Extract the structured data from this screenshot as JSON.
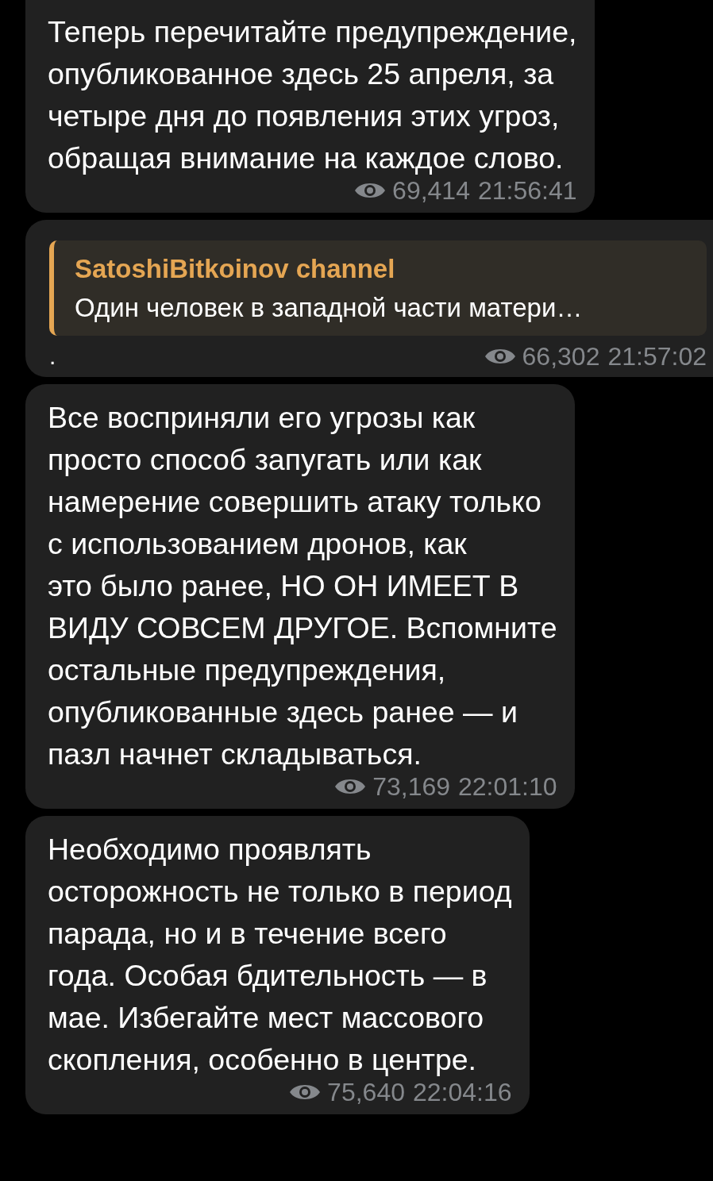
{
  "messages": [
    {
      "kind": "text",
      "text": "Теперь перечитайте предупреждение,\nопубликованное здесь 25 апреля, за\nчетыре дня до появления этих угроз,\nобращая внимание на каждое слово.",
      "views": "69,414",
      "time": "21:56:41"
    },
    {
      "kind": "quote",
      "quote": {
        "author": "SatoshiBitkoinov channel",
        "text": "Один человек в западной части матери…"
      },
      "text": ".",
      "views": "66,302",
      "time": "21:57:02"
    },
    {
      "kind": "text",
      "text": "Все восприняли его угрозы как\nпросто способ запугать или как\nнамерение совершить атаку только\nс использованием дронов, как\nэто было ранее, НО ОН ИМЕЕТ В\nВИДУ СОВСЕМ ДРУГОЕ. Вспомните\nостальные предупреждения,\nопубликованные здесь ранее — и\nпазл начнет складываться.",
      "views": "73,169",
      "time": "22:01:10"
    },
    {
      "kind": "text",
      "text": "Необходимо проявлять\nосторожность не только в период\nпарада, но и в течение всего\nгода. Особая бдительность — в\nмае. Избегайте мест массового\nскопления, особенно в центре.",
      "views": "75,640",
      "time": "22:04:16"
    }
  ]
}
